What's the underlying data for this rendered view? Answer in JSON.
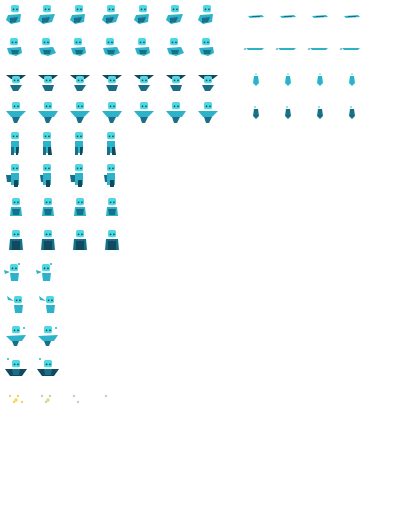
{
  "palette": {
    "light": "#4fd8e3",
    "mid": "#2cb3c9",
    "dark": "#1a6f86",
    "darkest": "#0f4b5c",
    "spark": "#f2d35a",
    "ghost": "#c9c9c9"
  },
  "sheet": {
    "rows": [
      {
        "name": "row-float-a",
        "pose": "float-tilt",
        "frames": 7
      },
      {
        "name": "row-float-b",
        "pose": "float-wave",
        "frames": 7
      },
      {
        "name": "row-hat",
        "pose": "hat",
        "frames": 7
      },
      {
        "name": "row-dance",
        "pose": "dance",
        "frames": 7
      },
      {
        "name": "row-walk-a",
        "pose": "walk",
        "frames": 4
      },
      {
        "name": "row-walk-b",
        "pose": "walk-arm",
        "frames": 4
      },
      {
        "name": "row-idle",
        "pose": "idle",
        "frames": 4
      },
      {
        "name": "row-dome",
        "pose": "dome",
        "frames": 4
      },
      {
        "name": "row-cast-a",
        "pose": "cast",
        "frames": 2
      },
      {
        "name": "row-cast-b",
        "pose": "cast-b",
        "frames": 2
      },
      {
        "name": "row-jump",
        "pose": "jump",
        "frames": 2
      },
      {
        "name": "row-spin",
        "pose": "spin",
        "frames": 2
      },
      {
        "name": "row-vanish",
        "pose": "vanish",
        "frames": 4
      }
    ],
    "projectile_rows": [
      {
        "name": "row-dash-a",
        "pose": "dash",
        "frames": 4
      },
      {
        "name": "row-dash-b",
        "pose": "dash2",
        "frames": 4
      },
      {
        "name": "row-drop-a",
        "pose": "drop",
        "frames": 4
      },
      {
        "name": "row-drop-b",
        "pose": "drop2",
        "frames": 4
      }
    ]
  }
}
